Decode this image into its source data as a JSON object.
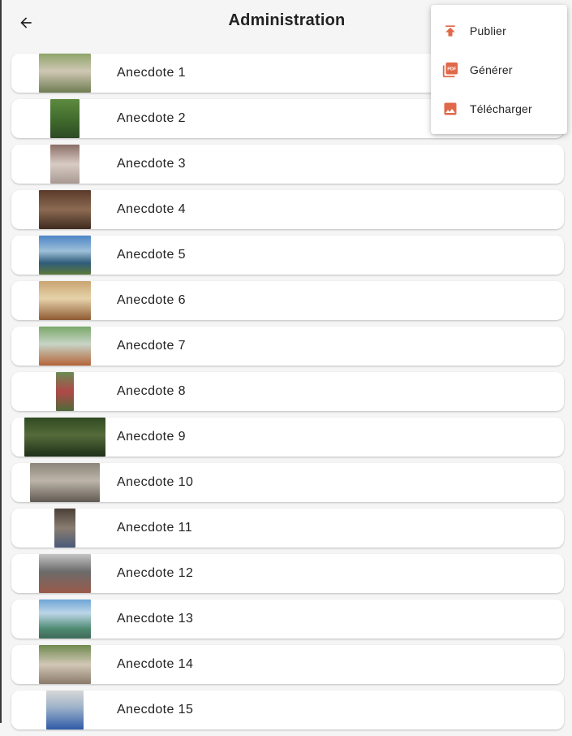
{
  "header": {
    "title": "Administration",
    "back_icon": "arrow-back-icon"
  },
  "accent_color": "#e0694a",
  "menu": {
    "items": [
      {
        "label": "Publier",
        "icon": "upload-icon"
      },
      {
        "label": "Générer",
        "icon": "pdf-icon"
      },
      {
        "label": "Télécharger",
        "icon": "image-icon"
      }
    ]
  },
  "anecdotes": [
    {
      "label": "Anecdote 1",
      "thumb": "photo-group-outdoor"
    },
    {
      "label": "Anecdote 2",
      "thumb": "photo-garden-tree"
    },
    {
      "label": "Anecdote 3",
      "thumb": "photo-table-cloth"
    },
    {
      "label": "Anecdote 4",
      "thumb": "photo-interior"
    },
    {
      "label": "Anecdote 5",
      "thumb": "photo-river-town"
    },
    {
      "label": "Anecdote 6",
      "thumb": "photo-church-interior"
    },
    {
      "label": "Anecdote 7",
      "thumb": "photo-dinner-table"
    },
    {
      "label": "Anecdote 8",
      "thumb": "photo-garden-path"
    },
    {
      "label": "Anecdote 9",
      "thumb": "photo-group-forest"
    },
    {
      "label": "Anecdote 10",
      "thumb": "photo-courtyard"
    },
    {
      "label": "Anecdote 11",
      "thumb": "photo-person-standing"
    },
    {
      "label": "Anecdote 12",
      "thumb": "photo-market"
    },
    {
      "label": "Anecdote 13",
      "thumb": "photo-river-city"
    },
    {
      "label": "Anecdote 14",
      "thumb": "photo-street-crowd"
    },
    {
      "label": "Anecdote 15",
      "thumb": "photo-building-blue"
    }
  ]
}
